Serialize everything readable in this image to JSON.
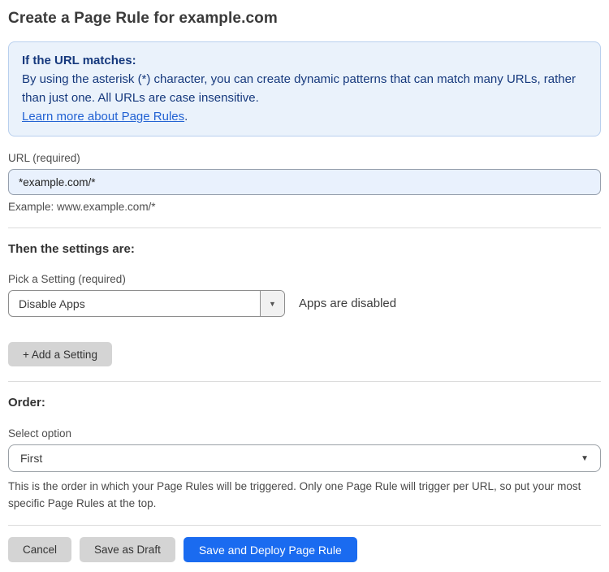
{
  "page": {
    "title": "Create a Page Rule for example.com"
  },
  "info_box": {
    "heading": "If the URL matches:",
    "body": "By using the asterisk (*) character, you can create dynamic patterns that can match many URLs, rather than just one. All URLs are case insensitive.",
    "link_label": "Learn more about Page Rules",
    "link_suffix": "."
  },
  "url_field": {
    "label": "URL (required)",
    "value": "*example.com/*",
    "example": "Example: www.example.com/*"
  },
  "settings_section": {
    "heading": "Then the settings are:",
    "picker_label": "Pick a Setting (required)",
    "picker_value": "Disable Apps",
    "picker_status": "Apps are disabled",
    "add_setting_label": "+ Add a Setting"
  },
  "order_section": {
    "heading": "Order:",
    "select_label": "Select option",
    "select_value": "First",
    "help_text": "This is the order in which your Page Rules will be triggered. Only one Page Rule will trigger per URL, so put your most specific Page Rules at the top."
  },
  "footer": {
    "cancel_label": "Cancel",
    "save_draft_label": "Save as Draft",
    "save_deploy_label": "Save and Deploy Page Rule"
  },
  "icons": {
    "caret_down": "▼"
  },
  "colors": {
    "accent_blue": "#1a6bf0",
    "info_background": "#eaf2fb",
    "info_border": "#b9d0ee",
    "info_text": "#16397d",
    "link_blue": "#2262d3",
    "url_input_background": "#e9f1fd",
    "button_gray": "#d4d4d4"
  }
}
